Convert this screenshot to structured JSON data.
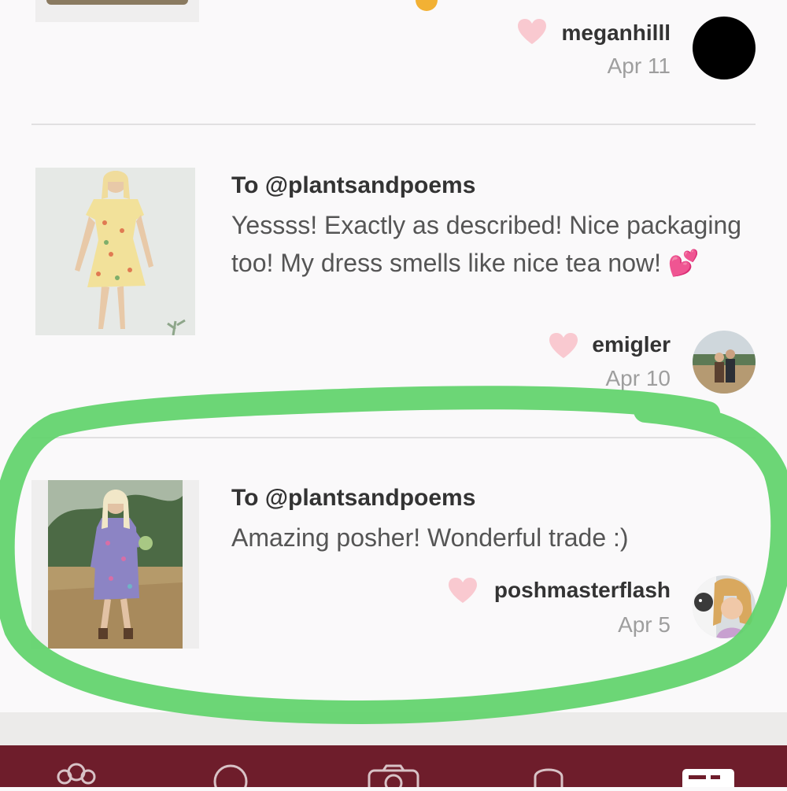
{
  "reviews": [
    {
      "username": "meganhilll",
      "date": "Apr 11"
    },
    {
      "to": "To @plantsandpoems",
      "text": "Yessss! Exactly as described! Nice packaging too! My dress smells like nice tea now! 💕",
      "username": "emigler",
      "date": "Apr 10"
    },
    {
      "to": "To @plantsandpoems",
      "text": "Amazing posher! Wonderful trade :)",
      "username": "poshmasterflash",
      "date": "Apr 5"
    }
  ],
  "tabbar": {
    "tabs": [
      {
        "icon": "feed-people-icon"
      },
      {
        "icon": "search-icon"
      },
      {
        "icon": "camera-icon"
      },
      {
        "icon": "notifications-icon"
      },
      {
        "icon": "account-icon"
      }
    ]
  },
  "colors": {
    "tabbar_background": "#6e1d2b",
    "heart": "#f9c9d0",
    "highlight": "#5fd26a"
  }
}
